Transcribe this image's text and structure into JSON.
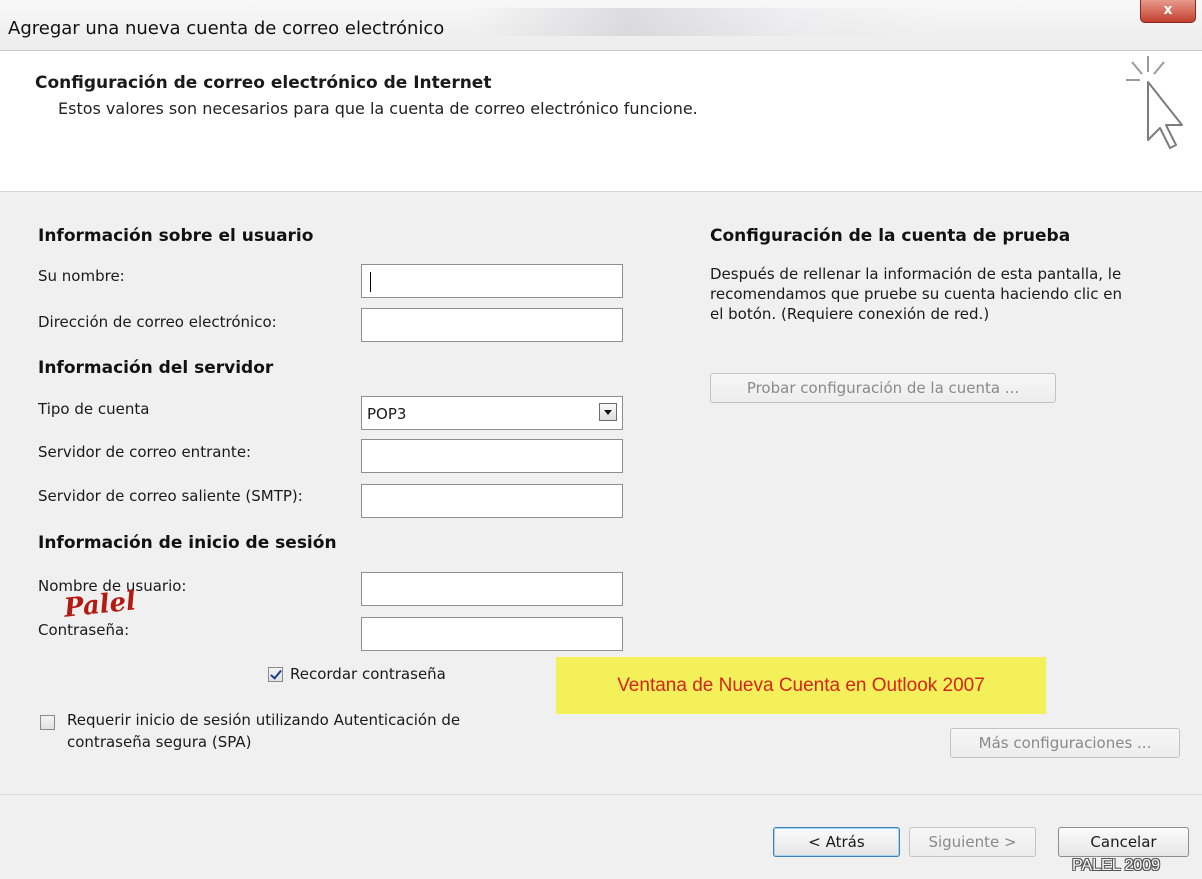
{
  "window": {
    "title": "Agregar una nueva cuenta de correo electrónico",
    "close_label": "x"
  },
  "header": {
    "title": "Configuración de correo electrónico de Internet",
    "subtitle": "Estos valores son necesarios para que la cuenta de correo electrónico funcione."
  },
  "user_info": {
    "section_title": "Información sobre el usuario",
    "name_label": "Su nombre:",
    "name_value": "",
    "email_label": "Dirección de correo electrónico:",
    "email_value": ""
  },
  "server_info": {
    "section_title": "Información del servidor",
    "account_type_label": "Tipo de cuenta",
    "account_type_value": "POP3",
    "incoming_label": "Servidor de correo entrante:",
    "incoming_value": "",
    "outgoing_label": "Servidor de correo saliente (SMTP):",
    "outgoing_value": ""
  },
  "login_info": {
    "section_title": "Información de inicio de sesión",
    "username_label": "Nombre de usuario:",
    "username_value": "",
    "password_label": "Contraseña:",
    "password_value": "",
    "remember_label": "Recordar contraseña",
    "remember_checked": true,
    "spa_label_line1": "Requerir inicio de sesión utilizando Autenticación de",
    "spa_label_line2": "contraseña segura (SPA)",
    "spa_checked": false
  },
  "test_config": {
    "section_title": "Configuración de la cuenta de prueba",
    "description_line1": "Después de rellenar la información de esta pantalla, le",
    "description_line2": "recomendamos que pruebe su cuenta haciendo clic en",
    "description_line3": "el botón. (Requiere conexión de red.)",
    "test_button_label": "Probar configuración de la cuenta ..."
  },
  "more_settings_label": "Más configuraciones ...",
  "annotation": "Ventana de Nueva Cuenta en Outlook 2007",
  "signature_text": "Palel",
  "footer": {
    "back_label": "< Atrás",
    "next_label": "Siguiente >",
    "cancel_label": "Cancelar"
  },
  "watermark": "PALEL 2009"
}
